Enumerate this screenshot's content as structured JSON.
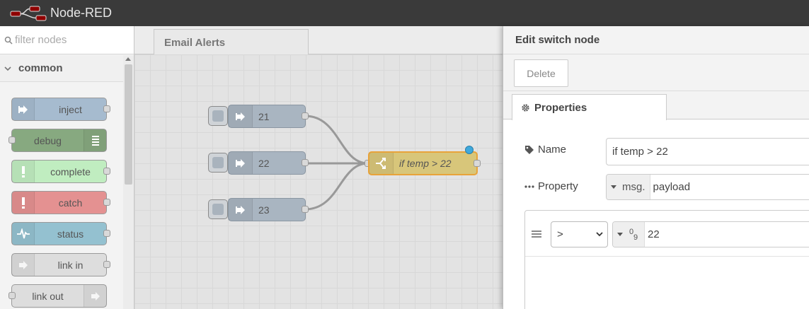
{
  "header": {
    "title": "Node-RED"
  },
  "palette": {
    "filter_placeholder": "filter nodes",
    "category": "common",
    "nodes": [
      {
        "label": "inject",
        "color": "#a6bbcf",
        "icon": "arrow-right-icon"
      },
      {
        "label": "debug",
        "color": "#87a980",
        "icon": "list-icon"
      },
      {
        "label": "complete",
        "color": "#c0edc0",
        "icon": "exclamation-icon"
      },
      {
        "label": "catch",
        "color": "#e49191",
        "icon": "exclamation-icon"
      },
      {
        "label": "status",
        "color": "#94c1d0",
        "icon": "pulse-icon"
      },
      {
        "label": "link in",
        "color": "#dddddd",
        "icon": "link-arrow-icon"
      },
      {
        "label": "link out",
        "color": "#dddddd",
        "icon": "link-arrow-icon"
      }
    ]
  },
  "workspace": {
    "tab": "Email Alerts",
    "inject_nodes": [
      {
        "label": "21"
      },
      {
        "label": "22"
      },
      {
        "label": "23"
      }
    ],
    "switch_node": {
      "label": "if temp > 22"
    }
  },
  "tray": {
    "title": "Edit switch node",
    "delete_label": "Delete",
    "tab_properties": "Properties",
    "name_label": "Name",
    "name_value": "if temp > 22",
    "property_label": "Property",
    "property_type": "msg.",
    "property_value": "payload",
    "rule": {
      "operator": ">",
      "value_type": "09",
      "value": "22"
    }
  }
}
